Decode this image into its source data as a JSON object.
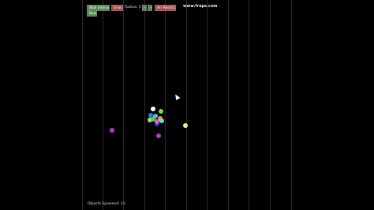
{
  "toolbar": {
    "wall_interaction_label": "Wall Interaction",
    "gravity_label": "Gravity",
    "radius_label": "Radius: 5",
    "minus_label": "-",
    "plus_label": "+",
    "air_resistance_label": "Air Resistance",
    "reset_label": "Reset"
  },
  "watermark": "www.fraps.com",
  "status": {
    "objects_spawned": "Objects Spawned: 13"
  },
  "balls": [
    {
      "color": "#b040c8"
    },
    {
      "color": "#f4f08a"
    },
    {
      "color": "#b040c8"
    },
    {
      "color": "#ffffff"
    },
    {
      "color": "#7fdc3a"
    },
    {
      "color": "#3e6be8"
    },
    {
      "color": "#44c8d8"
    },
    {
      "color": "#f0a020"
    },
    {
      "color": "#9be080"
    },
    {
      "color": "#2a3fd8"
    },
    {
      "color": "#60d040"
    },
    {
      "color": "#e060e0"
    },
    {
      "color": "#6ad8e8"
    }
  ]
}
